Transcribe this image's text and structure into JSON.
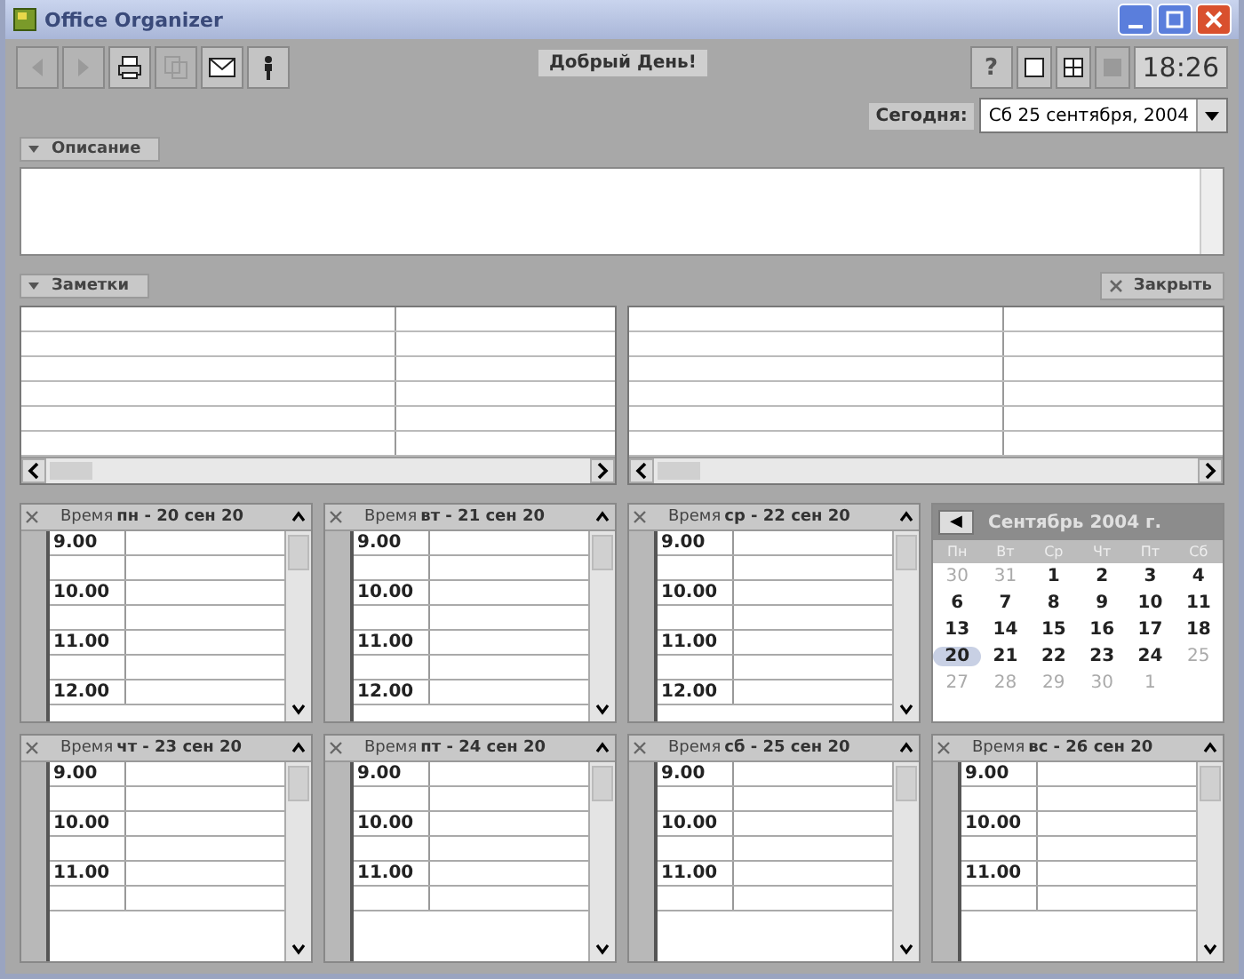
{
  "window": {
    "title": "Office Organizer"
  },
  "toolbar": {
    "tools": [
      {
        "kind": "back",
        "disabled": true
      },
      {
        "kind": "forward",
        "disabled": true
      },
      {
        "kind": "print",
        "disabled": false
      },
      {
        "kind": "copy",
        "disabled": true
      },
      {
        "kind": "mail",
        "disabled": false
      },
      {
        "kind": "person",
        "disabled": false
      }
    ],
    "greeting": "Добрый День!",
    "help": "?",
    "views": [
      {
        "kind": "single",
        "disabled": false
      },
      {
        "kind": "grid",
        "disabled": false
      },
      {
        "kind": "list",
        "disabled": true
      }
    ],
    "clock": "18:26"
  },
  "today": {
    "label": "Сегодня:",
    "value": "Сб 25 сентября, 2004"
  },
  "description": {
    "label": "Описание",
    "expanded": true
  },
  "notes": {
    "label": "Заметки",
    "close_label": "Закрыть"
  },
  "days": [
    {
      "header": "Время",
      "date": "пн - 20 сен 20",
      "slots": [
        "9.00",
        "10.00",
        "11.00",
        "12.00"
      ]
    },
    {
      "header": "Время",
      "date": "вт - 21 сен 20",
      "slots": [
        "9.00",
        "10.00",
        "11.00",
        "12.00"
      ]
    },
    {
      "header": "Время",
      "date": "ср - 22 сен 20",
      "slots": [
        "9.00",
        "10.00",
        "11.00",
        "12.00"
      ]
    },
    {
      "header": "Время",
      "date": "чт - 23 сен 20",
      "slots": [
        "9.00",
        "10.00",
        "11.00"
      ]
    },
    {
      "header": "Время",
      "date": "пт - 24 сен 20",
      "slots": [
        "9.00",
        "10.00",
        "11.00"
      ]
    },
    {
      "header": "Время",
      "date": "сб - 25 сен 20",
      "slots": [
        "9.00",
        "10.00",
        "11.00"
      ]
    },
    {
      "header": "Время",
      "date": "вс - 26 сен 20",
      "slots": [
        "9.00",
        "10.00",
        "11.00"
      ]
    }
  ],
  "calendar": {
    "prev": "◀",
    "title": "Сентябрь 2004 г.",
    "weekdays": [
      "Пн",
      "Вт",
      "Ср",
      "Чт",
      "Пт",
      "Сб"
    ],
    "weeks": [
      [
        {
          "day": "30",
          "other_month": true,
          "selected": false
        },
        {
          "day": "31",
          "other_month": true,
          "selected": false
        },
        {
          "day": "1",
          "other_month": false,
          "selected": false
        },
        {
          "day": "2",
          "other_month": false,
          "selected": false
        },
        {
          "day": "3",
          "other_month": false,
          "selected": false
        },
        {
          "day": "4",
          "other_month": false,
          "selected": false
        }
      ],
      [
        {
          "day": "6",
          "other_month": false,
          "selected": false
        },
        {
          "day": "7",
          "other_month": false,
          "selected": false
        },
        {
          "day": "8",
          "other_month": false,
          "selected": false
        },
        {
          "day": "9",
          "other_month": false,
          "selected": false
        },
        {
          "day": "10",
          "other_month": false,
          "selected": false
        },
        {
          "day": "11",
          "other_month": false,
          "selected": false
        }
      ],
      [
        {
          "day": "13",
          "other_month": false,
          "selected": false
        },
        {
          "day": "14",
          "other_month": false,
          "selected": false
        },
        {
          "day": "15",
          "other_month": false,
          "selected": false
        },
        {
          "day": "16",
          "other_month": false,
          "selected": false
        },
        {
          "day": "17",
          "other_month": false,
          "selected": false
        },
        {
          "day": "18",
          "other_month": false,
          "selected": false
        }
      ],
      [
        {
          "day": "20",
          "other_month": false,
          "selected": true
        },
        {
          "day": "21",
          "other_month": false,
          "selected": false
        },
        {
          "day": "22",
          "other_month": false,
          "selected": false
        },
        {
          "day": "23",
          "other_month": false,
          "selected": false
        },
        {
          "day": "24",
          "other_month": false,
          "selected": false
        },
        {
          "day": "25",
          "other_month": true,
          "selected": false
        }
      ],
      [
        {
          "day": "27",
          "other_month": true,
          "selected": false
        },
        {
          "day": "28",
          "other_month": true,
          "selected": false
        },
        {
          "day": "29",
          "other_month": true,
          "selected": false
        },
        {
          "day": "30",
          "other_month": true,
          "selected": false
        },
        {
          "day": "1",
          "other_month": true,
          "selected": false
        }
      ]
    ]
  }
}
